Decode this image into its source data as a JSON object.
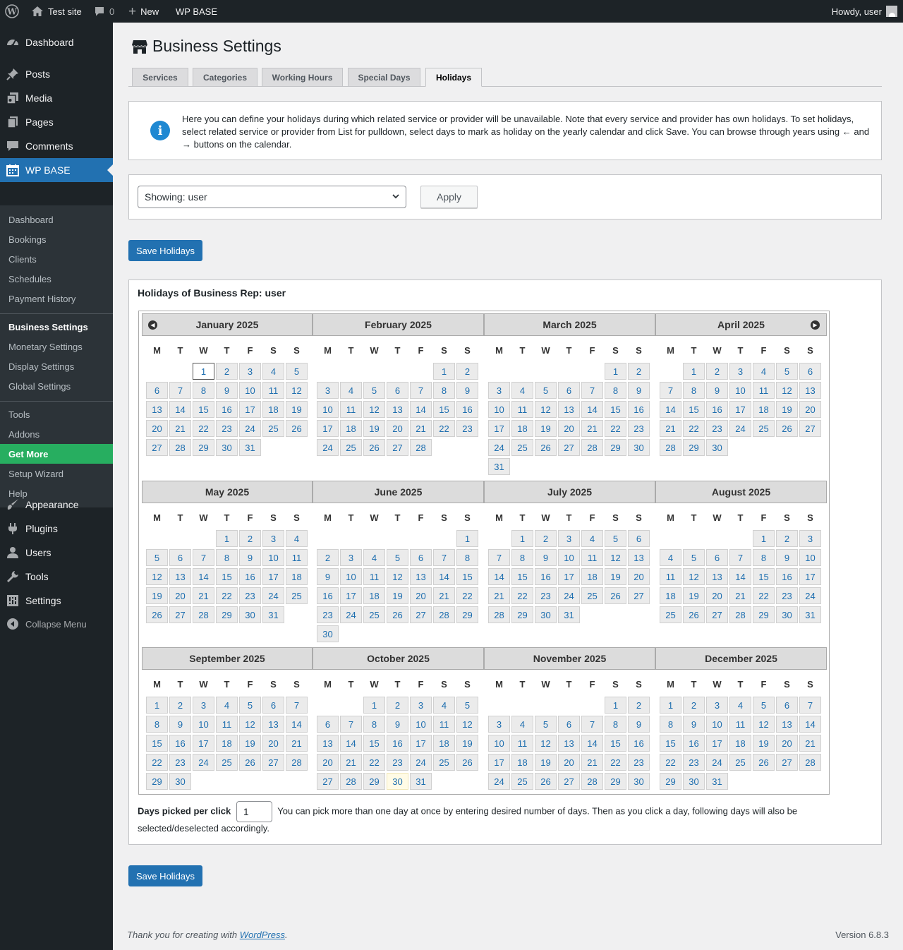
{
  "adminbar": {
    "site_name": "Test site",
    "comments_count": "0",
    "new_label": "New",
    "plugin_label": "WP BASE",
    "howdy": "Howdy, user"
  },
  "sidebar": {
    "menu_top": [
      {
        "label": "Dashboard",
        "icon": "dashboard-icon"
      },
      {
        "label": "Posts",
        "icon": "pin-icon"
      },
      {
        "label": "Media",
        "icon": "media-icon"
      },
      {
        "label": "Pages",
        "icon": "page-icon"
      },
      {
        "label": "Comments",
        "icon": "comment-icon"
      },
      {
        "label": "WP BASE",
        "icon": "calendar-icon"
      }
    ],
    "submenu": [
      "Dashboard",
      "Bookings",
      "Clients",
      "Schedules",
      "Payment History",
      "Business Settings",
      "Monetary Settings",
      "Display Settings",
      "Global Settings",
      "Tools",
      "Addons",
      "Get More",
      "Setup Wizard",
      "Help"
    ],
    "menu_bottom": [
      {
        "label": "Appearance",
        "icon": "brush-icon"
      },
      {
        "label": "Plugins",
        "icon": "plugin-icon"
      },
      {
        "label": "Users",
        "icon": "user-icon"
      },
      {
        "label": "Tools",
        "icon": "wrench-icon"
      },
      {
        "label": "Settings",
        "icon": "settings-icon"
      }
    ],
    "collapse_label": "Collapse Menu"
  },
  "page": {
    "title": "Business Settings",
    "tabs": [
      "Services",
      "Categories",
      "Working Hours",
      "Special Days",
      "Holidays"
    ],
    "active_tab": "Holidays",
    "info_text": "Here you can define your holidays during which related service or provider will be unavailable. Note that every service and provider has own holidays. To set holidays, select related service or provider from List for pulldown, select days to mark as holiday on the yearly calendar and click Save. You can browse through years using ← and → buttons on the calendar.",
    "select_value": "Showing: user",
    "apply_label": "Apply",
    "save_label": "Save Holidays",
    "holidays_title": "Holidays of Business Rep: user",
    "pick_label": "Days picked per click",
    "pick_value": "1",
    "pick_help": "You can pick more than one day at once by entering desired number of days. Then as you click a day, following days will also be selected/deselected accordingly."
  },
  "calendar": {
    "weekdays": [
      "M",
      "T",
      "W",
      "T",
      "F",
      "S",
      "S"
    ],
    "selected_date": "January 1",
    "today_date": "October 30",
    "months": [
      {
        "name": "January 2025",
        "offset": 2,
        "days": 31
      },
      {
        "name": "February 2025",
        "offset": 5,
        "days": 28
      },
      {
        "name": "March 2025",
        "offset": 5,
        "days": 31
      },
      {
        "name": "April 2025",
        "offset": 1,
        "days": 30
      },
      {
        "name": "May 2025",
        "offset": 3,
        "days": 31
      },
      {
        "name": "June 2025",
        "offset": 6,
        "days": 30
      },
      {
        "name": "July 2025",
        "offset": 1,
        "days": 31
      },
      {
        "name": "August 2025",
        "offset": 4,
        "days": 31
      },
      {
        "name": "September 2025",
        "offset": 0,
        "days": 30
      },
      {
        "name": "October 2025",
        "offset": 2,
        "days": 31
      },
      {
        "name": "November 2025",
        "offset": 5,
        "days": 30
      },
      {
        "name": "December 2025",
        "offset": 0,
        "days": 31
      }
    ]
  },
  "footer": {
    "thanks_prefix": "Thank you for creating with ",
    "wp_link": "WordPress",
    "thanks_suffix": ".",
    "version": "Version 6.8.3"
  },
  "colors": {
    "accent": "#2271b1",
    "getmore": "#27ae60",
    "adminbar": "#1d2327",
    "submenu_bg": "#2c3338"
  }
}
